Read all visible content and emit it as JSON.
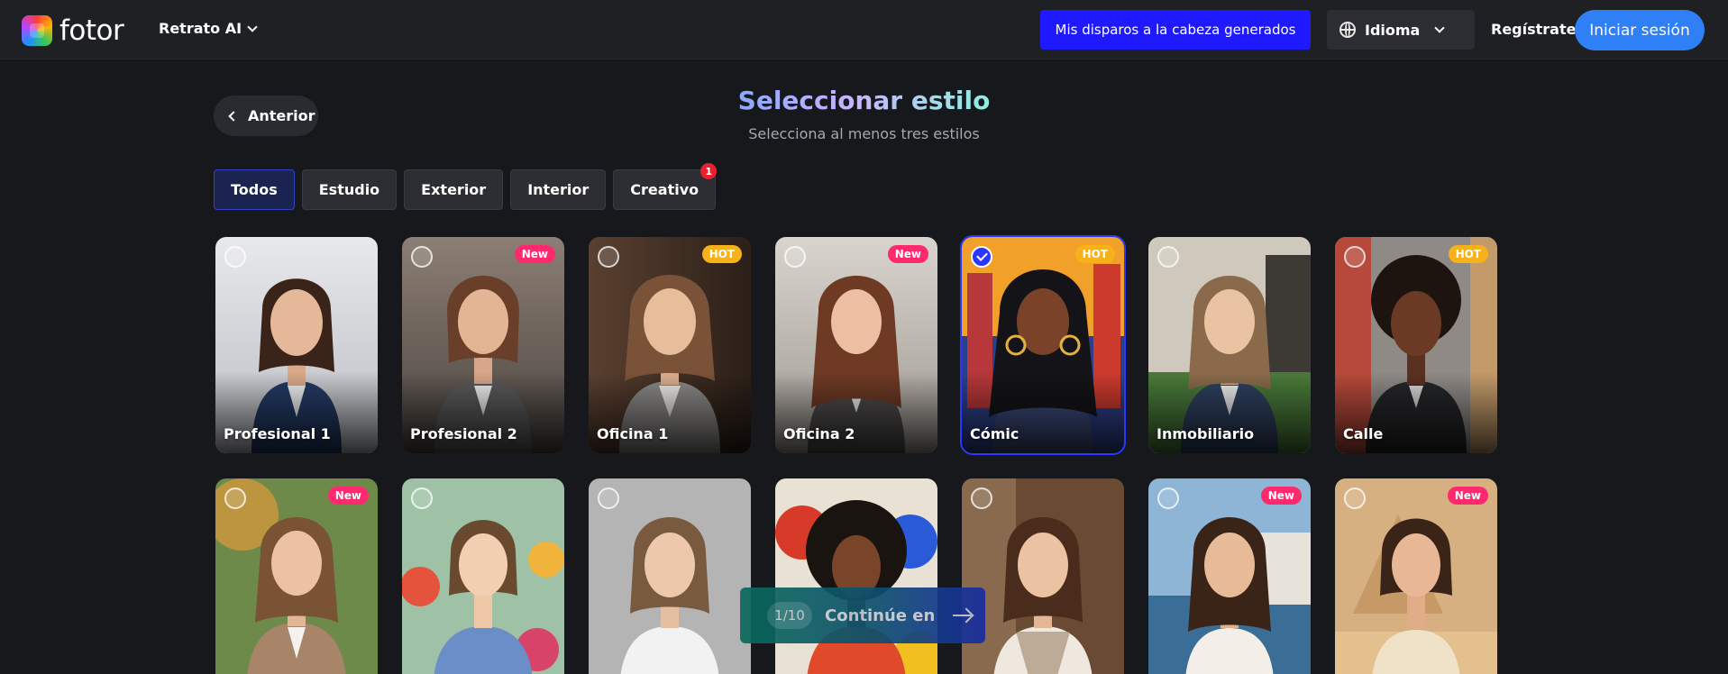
{
  "header": {
    "logo_text": "fotor",
    "nav_label": "Retrato AI",
    "headshots_button": "Mis disparos a la cabeza generados",
    "language_label": "Idioma",
    "register_label": "Regístrate",
    "login_label": "Iniciar sesión"
  },
  "back_label": "Anterior",
  "title": "Seleccionar estilo",
  "subtitle": "Selecciona al menos tres estilos",
  "filters": [
    {
      "label": "Todos",
      "active": true
    },
    {
      "label": "Estudio",
      "active": false
    },
    {
      "label": "Exterior",
      "active": false
    },
    {
      "label": "Interior",
      "active": false
    },
    {
      "label": "Creativo",
      "active": false,
      "badge": "1"
    }
  ],
  "styles_row1": [
    {
      "label": "Profesional 1",
      "tag": "",
      "selected": false
    },
    {
      "label": "Profesional 2",
      "tag": "New",
      "selected": false
    },
    {
      "label": "Oficina 1",
      "tag": "HOT",
      "selected": false
    },
    {
      "label": "Oficina 2",
      "tag": "New",
      "selected": false
    },
    {
      "label": "Cómic",
      "tag": "HOT",
      "selected": true
    },
    {
      "label": "Inmobiliario",
      "tag": "",
      "selected": false
    },
    {
      "label": "Calle",
      "tag": "HOT",
      "selected": false
    }
  ],
  "styles_row2": [
    {
      "label": "",
      "tag": "New",
      "selected": false
    },
    {
      "label": "",
      "tag": "",
      "selected": false
    },
    {
      "label": "",
      "tag": "",
      "selected": false
    },
    {
      "label": "",
      "tag": "",
      "selected": false
    },
    {
      "label": "",
      "tag": "",
      "selected": false
    },
    {
      "label": "",
      "tag": "New",
      "selected": false
    },
    {
      "label": "",
      "tag": "New",
      "selected": false
    }
  ],
  "continue": {
    "counter": "1/10",
    "label": "Continúe en"
  },
  "colors": {
    "accent_blue": "#1f19ff",
    "login_blue": "#2f80f6",
    "tag_new": "#ff2a6d",
    "tag_hot": "#f7b21b"
  }
}
